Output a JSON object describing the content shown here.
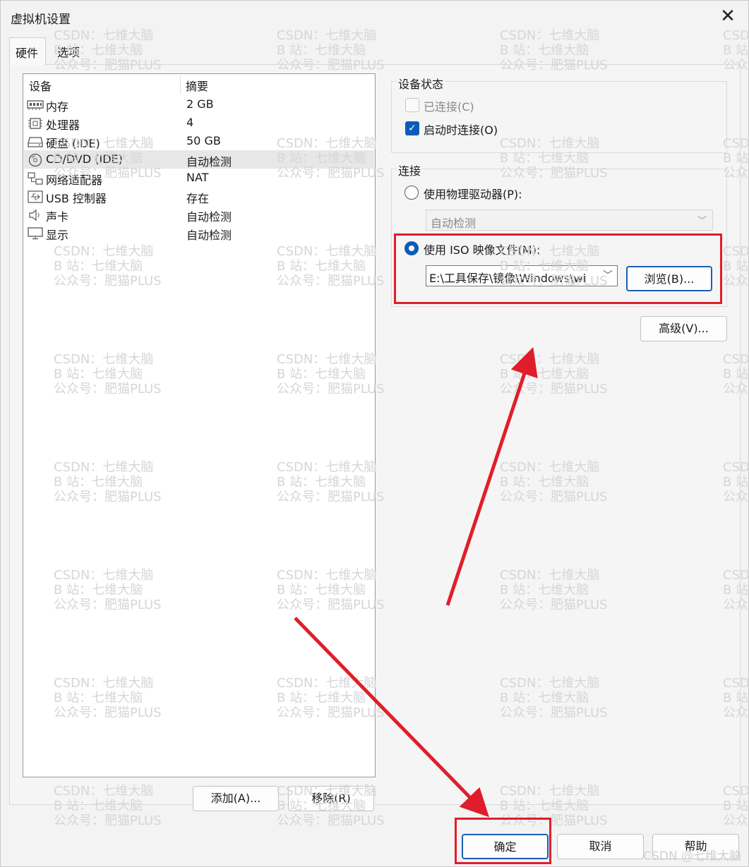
{
  "window": {
    "title": "虚拟机设置",
    "close_glyph": "✕"
  },
  "tabs": [
    {
      "label": "硬件",
      "active": true
    },
    {
      "label": "选项",
      "active": false
    }
  ],
  "device_list": {
    "headers": {
      "device": "设备",
      "summary": "摘要"
    },
    "rows": [
      {
        "name": "内存",
        "summary": "2 GB",
        "icon": "memory-icon",
        "selected": false
      },
      {
        "name": "处理器",
        "summary": "4",
        "icon": "processor-icon",
        "selected": false
      },
      {
        "name": "硬盘 (IDE)",
        "summary": "50 GB",
        "icon": "harddisk-icon",
        "selected": false
      },
      {
        "name": "CD/DVD (IDE)",
        "summary": "自动检测",
        "icon": "cd-dvd-icon",
        "selected": true
      },
      {
        "name": "网络适配器",
        "summary": "NAT",
        "icon": "network-adapter-icon",
        "selected": false
      },
      {
        "name": "USB 控制器",
        "summary": "存在",
        "icon": "usb-icon",
        "selected": false
      },
      {
        "name": "声卡",
        "summary": "自动检测",
        "icon": "speaker-icon",
        "selected": false
      },
      {
        "name": "显示",
        "summary": "自动检测",
        "icon": "monitor-icon",
        "selected": false
      }
    ]
  },
  "list_buttons": {
    "add": "添加(A)...",
    "remove": "移除(R)"
  },
  "device_status": {
    "title": "设备状态",
    "connected": {
      "label": "已连接(C)",
      "checked": false,
      "enabled": false
    },
    "connect_at_power_on": {
      "label": "启动时连接(O)",
      "checked": true,
      "enabled": true
    }
  },
  "connection": {
    "title": "连接",
    "physical_drive": {
      "label": "使用物理驱动器(P):",
      "selected": false,
      "value": "自动检测"
    },
    "iso_image": {
      "label": "使用 ISO 映像文件(M):",
      "selected": true,
      "path": "E:\\工具保存\\镜像\\Windows\\wi"
    },
    "browse": "浏览(B)...",
    "advanced": "高级(V)..."
  },
  "footer_buttons": {
    "ok": "确定",
    "cancel": "取消",
    "help": "帮助"
  },
  "watermark": {
    "lines": [
      "CSDN：七维大脑",
      "B 站：七维大脑",
      "公众号：肥猫PLUS"
    ],
    "credit": "CSDN @七维大脑"
  },
  "colors": {
    "accent": "#0b5cb8",
    "annotation_red": "#e01e2b",
    "watermark": "#d6d6d6"
  }
}
